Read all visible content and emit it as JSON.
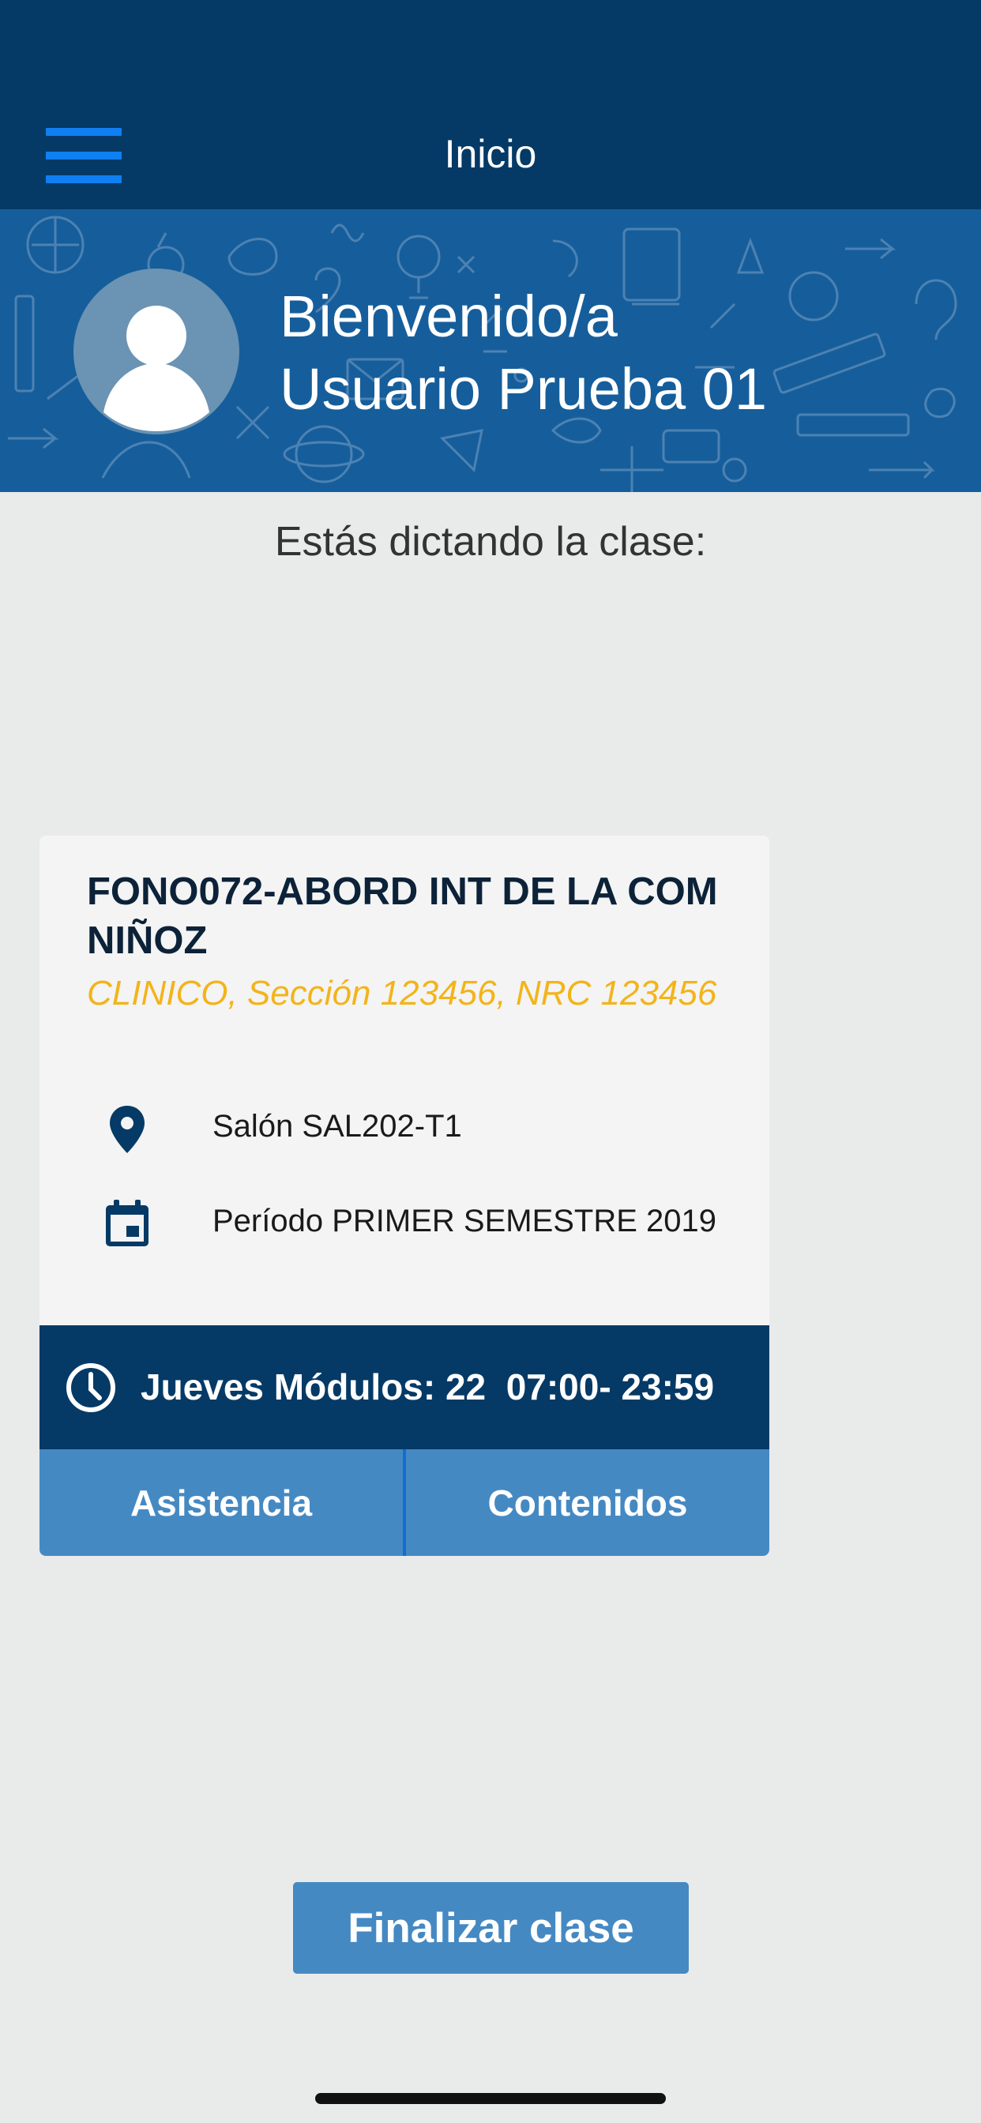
{
  "header": {
    "title": "Inicio",
    "menu_icon": "hamburger-menu-icon",
    "background_color": "#053a66",
    "menu_color": "#0f7ff2"
  },
  "banner": {
    "welcome_line1": "Bienvenido/a",
    "welcome_line2": "Usuario Prueba 01",
    "avatar_icon": "user-avatar-icon",
    "background_color": "#165e9b"
  },
  "main": {
    "intro_text": "Estás dictando la clase:"
  },
  "class_card": {
    "title": "FONO072-ABORD INT DE LA COM NIÑOZ",
    "subtitle": "CLINICO, Sección 123456, NRC 123456",
    "subtitle_color": "#f3b41a",
    "room": {
      "icon": "location-pin-icon",
      "text": "Salón SAL202-T1"
    },
    "period": {
      "icon": "calendar-icon",
      "text": "Período PRIMER SEMESTRE 2019"
    },
    "schedule": {
      "icon": "clock-icon",
      "text": "Jueves Módulos: 22  07:00- 23:59"
    },
    "buttons": {
      "attendance": "Asistencia",
      "contents": "Contenidos"
    },
    "button_color": "#4589c3"
  },
  "footer": {
    "finish_button": "Finalizar clase"
  }
}
